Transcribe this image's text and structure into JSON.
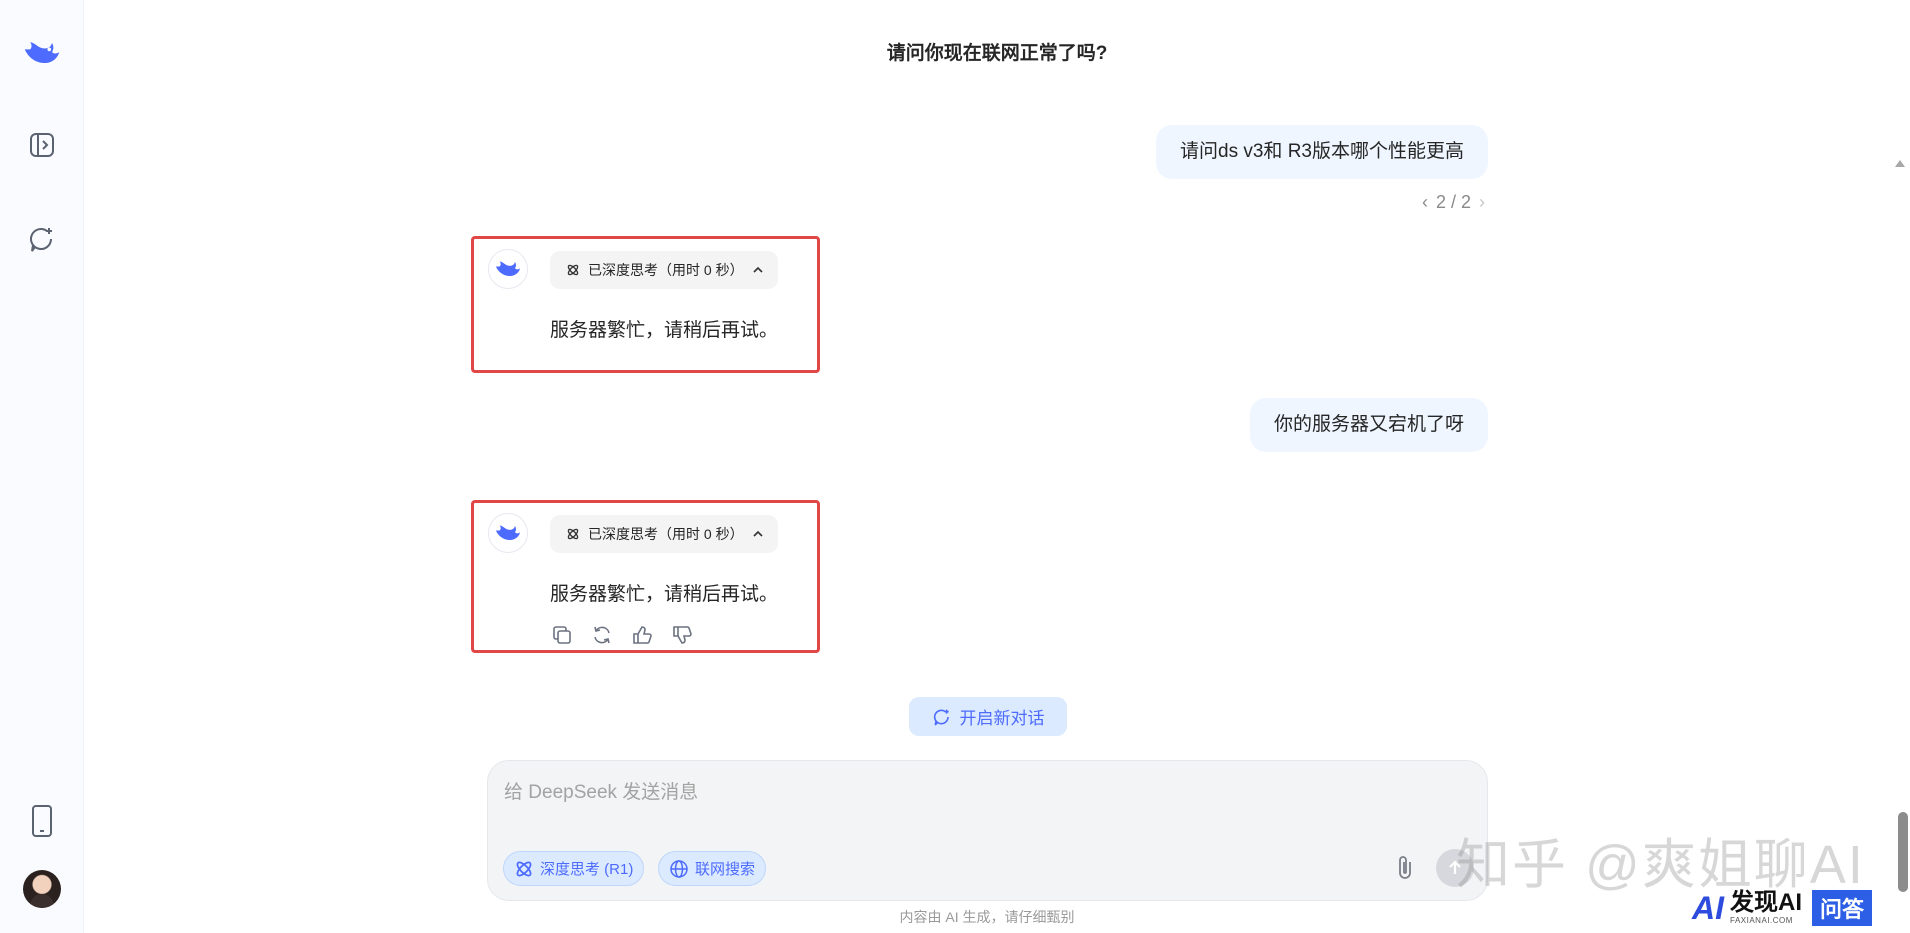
{
  "conversation_title": "请问你现在联网正常了吗?",
  "messages": {
    "user_1": "请问ds v3和 R3版本哪个性能更高",
    "user_1_pager": "2 / 2",
    "ai_1": {
      "think_label": "已深度思考（用时 0 秒）",
      "text": "服务器繁忙，请稍后再试。"
    },
    "user_2": "你的服务器又宕机了呀",
    "ai_2": {
      "think_label": "已深度思考（用时 0 秒）",
      "text": "服务器繁忙，请稍后再试。"
    }
  },
  "new_chat_label": "开启新对话",
  "composer": {
    "placeholder": "给 DeepSeek 发送消息",
    "deep_think_label": "深度思考 (R1)",
    "web_search_label": "联网搜索"
  },
  "disclaimer": "内容由 AI 生成，请仔细甄别",
  "watermark": "知乎 @爽姐聊AI",
  "brand": {
    "mark": "AI",
    "name": "发现AI",
    "site": "FAXIANAI.COM",
    "badge": "问答"
  },
  "colors": {
    "accent": "#4d6bfe",
    "highlight_border": "#e04848",
    "user_bubble": "#eff6ff"
  }
}
